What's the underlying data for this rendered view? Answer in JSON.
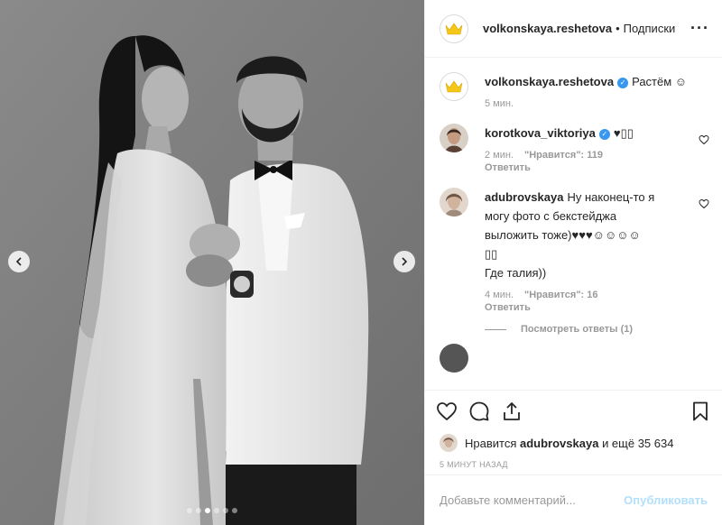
{
  "post": {
    "username": "volkonskaya.reshetova",
    "separator": "•",
    "follow_label": "Подписки",
    "more_label": "···"
  },
  "caption": {
    "username": "volkonskaya.reshetova",
    "text": "Растём ☺",
    "time": "5 мин."
  },
  "comments": [
    {
      "username": "korotkova_viktoriya",
      "verified": true,
      "text": "♥▯▯",
      "time": "2 мин.",
      "likes_label": "\"Нравится\": 119",
      "reply_label": "Ответить"
    },
    {
      "username": "adubrovskaya",
      "verified": false,
      "text_line1": "Ну наконец-то я",
      "text_line2": "могу фото с бекстейджа",
      "text_line3": "выложить тоже)♥♥♥☺☺☺☺",
      "text_line4": "▯▯",
      "text_line5": "Где талия))",
      "time": "4 мин.",
      "likes_label": "\"Нравится\": 16",
      "reply_label": "Ответить",
      "view_replies": "Посмотреть ответы (1)"
    }
  ],
  "actions": {
    "like_icon": "heart-icon",
    "comment_icon": "comment-icon",
    "share_icon": "share-icon",
    "save_icon": "bookmark-icon"
  },
  "liked_by": {
    "prefix": "Нравится",
    "user": "adubrovskaya",
    "suffix": "и ещё 35 634"
  },
  "timestamp": "5 минут назад",
  "add_comment": {
    "placeholder": "Добавьте комментарий...",
    "publish_label": "Опубликовать"
  },
  "carousel": {
    "total": 6,
    "active": 3
  },
  "colors": {
    "verified": "#3897f0",
    "publish_disabled": "#b2dffc",
    "crown": "#f5c518"
  }
}
